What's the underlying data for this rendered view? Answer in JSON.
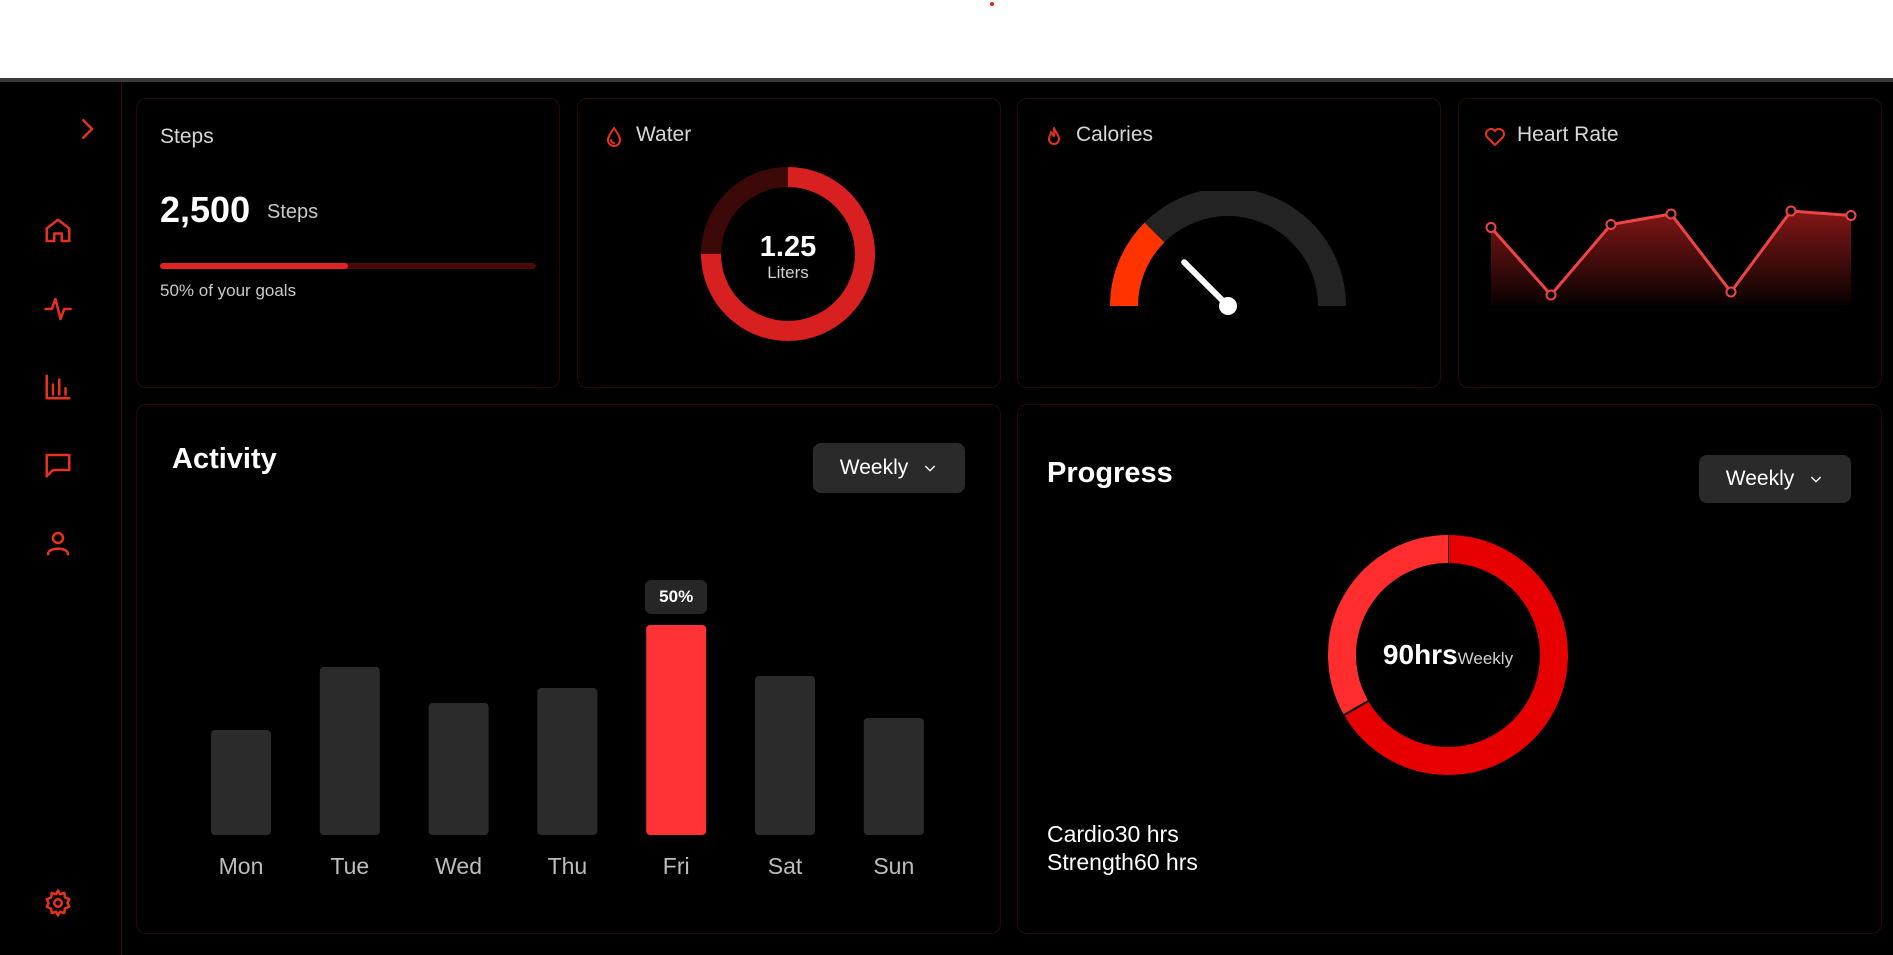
{
  "cards": {
    "steps": {
      "title": "Steps",
      "value": "2,500",
      "unit": "Steps",
      "goal_text": "50% of your goals",
      "progress": 0.5
    },
    "water": {
      "title": "Water",
      "value": "1.25",
      "unit": "Liters",
      "fill": 0.75
    },
    "calories": {
      "title": "Calories",
      "gauge_level": 0.25
    },
    "heart": {
      "title": "Heart Rate",
      "points": [
        65,
        20,
        67,
        74,
        22,
        76,
        73
      ]
    }
  },
  "activity": {
    "title": "Activity",
    "range_label": "Weekly",
    "tooltip": "50%",
    "highlight_index": 4,
    "days": [
      "Mon",
      "Tue",
      "Wed",
      "Thu",
      "Fri",
      "Sat",
      "Sun"
    ],
    "values": [
      35,
      56,
      44,
      49,
      70,
      53,
      39
    ]
  },
  "progress": {
    "title": "Progress",
    "range_label": "Weekly",
    "center_value": "90hrs",
    "center_label": "Weekly",
    "items": [
      {
        "name": "Cardio",
        "hours": "30 hrs"
      },
      {
        "name": "Strength",
        "hours": "60 hrs"
      }
    ]
  },
  "colors": {
    "accent": "#e8321e",
    "bar": "#2b2b2b",
    "highlight": "#ff3236",
    "ring": "#d82020"
  }
}
